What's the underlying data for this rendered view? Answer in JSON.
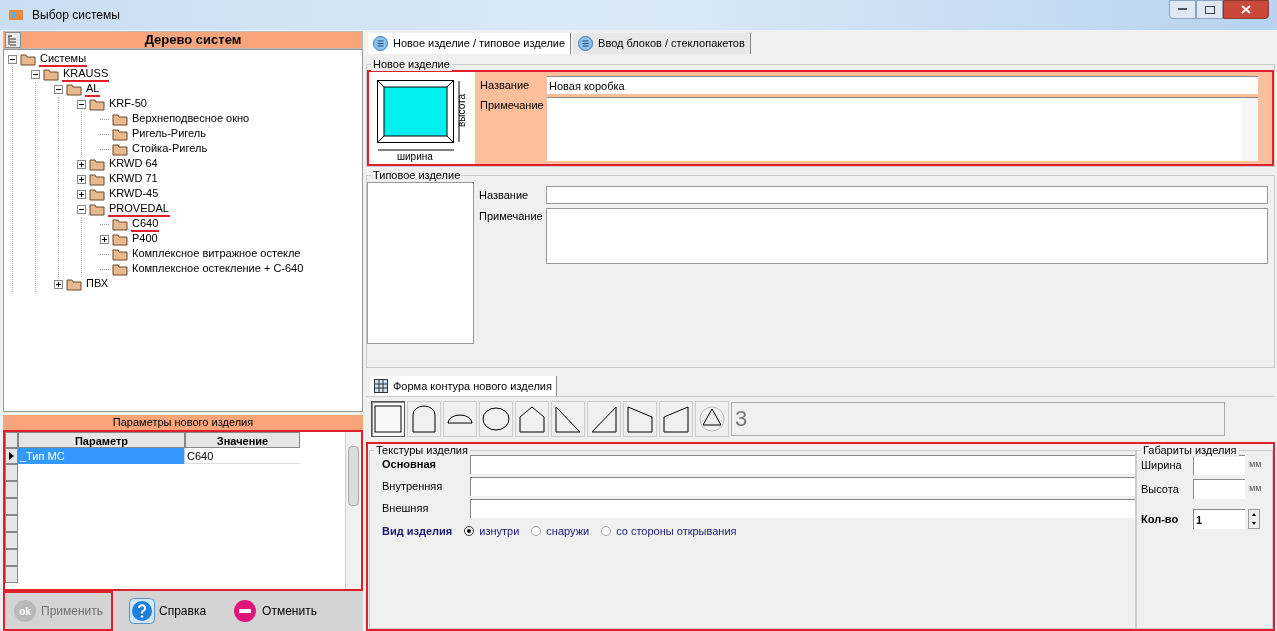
{
  "window": {
    "title": "Выбор системы"
  },
  "tree_panel": {
    "title": "Дерево систем",
    "items": [
      {
        "label": "Системы",
        "expanded": true,
        "marked": true,
        "children": [
          {
            "label": "KRAUSS",
            "expanded": true,
            "marked": true,
            "children": [
              {
                "label": "AL",
                "expanded": true,
                "marked": true,
                "children": [
                  {
                    "label": "KRF-50",
                    "expanded": true,
                    "marked": false,
                    "children": [
                      {
                        "label": "Верхнеподвесное окно",
                        "marked": false
                      },
                      {
                        "label": "Ригель-Ригель",
                        "marked": false
                      },
                      {
                        "label": "Стойка-Ригель",
                        "marked": false
                      }
                    ]
                  },
                  {
                    "label": "KRWD 64",
                    "expanded": false,
                    "marked": false
                  },
                  {
                    "label": "KRWD 71",
                    "expanded": false,
                    "marked": false
                  },
                  {
                    "label": "KRWD-45",
                    "expanded": false,
                    "marked": false
                  },
                  {
                    "label": "PROVEDAL",
                    "expanded": true,
                    "marked": true,
                    "children": [
                      {
                        "label": "C640",
                        "marked": true
                      },
                      {
                        "label": "P400",
                        "expanded": false,
                        "marked": false
                      },
                      {
                        "label": "Комплексное витражное остекле",
                        "marked": false
                      },
                      {
                        "label": "Комплексное остекление + С-640",
                        "marked": false
                      }
                    ]
                  }
                ]
              },
              {
                "label": "ПВХ",
                "expanded": false,
                "marked": false
              }
            ]
          }
        ]
      }
    ]
  },
  "params": {
    "title": "Параметры нового изделия",
    "highlighted": true,
    "columns": [
      "Параметр",
      "Значение"
    ],
    "rows": [
      {
        "selected": true,
        "cells": [
          "_Тип МС",
          "C640"
        ]
      }
    ]
  },
  "buttons": [
    {
      "label": "Применить",
      "kind": "ok",
      "disabled": true,
      "highlighted": true
    },
    {
      "label": "Справка",
      "kind": "help",
      "disabled": false,
      "highlighted": false
    },
    {
      "label": "Отменить",
      "kind": "cancel",
      "disabled": false,
      "highlighted": false
    }
  ],
  "tabs": [
    {
      "label": "Новое изделие / типовое изделие",
      "selected": true
    },
    {
      "label": "Ввод блоков / стеклопакетов",
      "selected": false
    }
  ],
  "new_product": {
    "title": "Новое изделие",
    "highlighted": true,
    "preview_width": "ширина",
    "preview_height": "высота",
    "name_label": "Название",
    "name_value": "Новая коробка",
    "note_label": "Примечание"
  },
  "typical_product": {
    "title": "Типовое изделие",
    "name_label": "Название",
    "note_label": "Примечание"
  },
  "shape_tab": {
    "label": "Форма контура нового изделия"
  },
  "shapes": [
    {
      "kind": "rect",
      "selected": true
    },
    {
      "kind": "arch",
      "selected": false
    },
    {
      "kind": "half",
      "selected": false
    },
    {
      "kind": "oval",
      "selected": false
    },
    {
      "kind": "house",
      "selected": false
    },
    {
      "kind": "tri-left",
      "selected": false
    },
    {
      "kind": "tri-right",
      "selected": false
    },
    {
      "kind": "trap-left",
      "selected": false
    },
    {
      "kind": "trap-right",
      "selected": false
    },
    {
      "kind": "circle-tri",
      "selected": false
    }
  ],
  "shape_count": "3",
  "textures": {
    "title": "Текстуры изделия",
    "highlighted": true,
    "rows": [
      {
        "label": "Основная",
        "bold": true
      },
      {
        "label": "Внутренняя",
        "bold": false
      },
      {
        "label": "Внешняя",
        "bold": false
      }
    ],
    "view_label": "Вид изделия",
    "view_options": [
      {
        "label": "изнутри",
        "selected": true
      },
      {
        "label": "снаружи",
        "selected": false
      },
      {
        "label": "со стороны открывания",
        "selected": false
      }
    ]
  },
  "dimensions": {
    "title": "Габариты изделия",
    "rows": [
      {
        "label": "Ширина",
        "unit": "мм"
      },
      {
        "label": "Высота",
        "unit": "мм"
      }
    ],
    "qty_label": "Кол-во",
    "qty_value": "1"
  }
}
